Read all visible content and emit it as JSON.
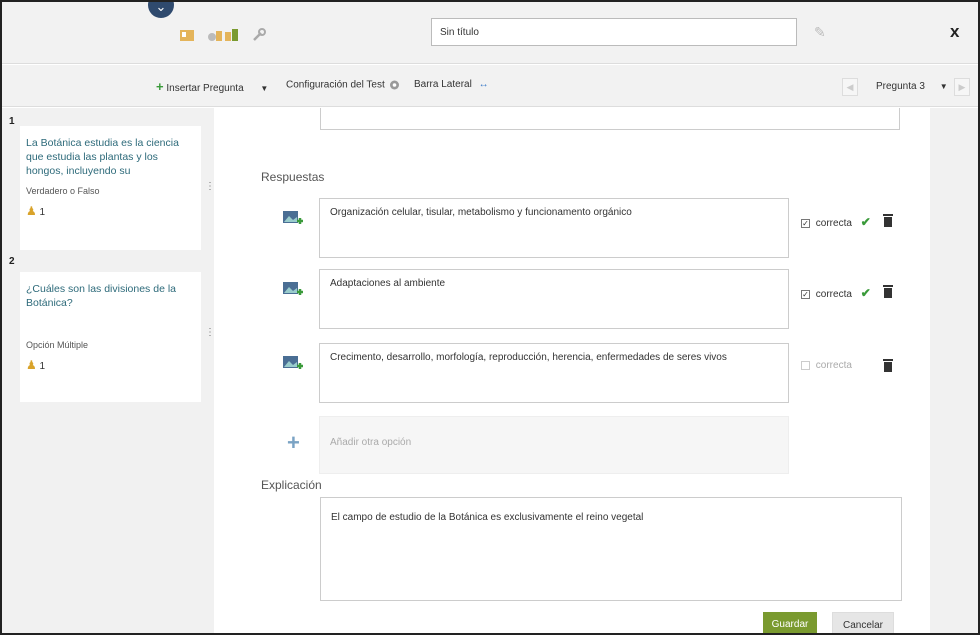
{
  "header": {
    "title_value": "Sin título",
    "close_label": "x"
  },
  "toolbar": {
    "insert_label": "Insertar Pregunta",
    "config_label": "Configuración del Test",
    "sidebar_label": "Barra Lateral",
    "pregunta_select": "Pregunta 3"
  },
  "questions": [
    {
      "number": "1",
      "text": "La Botánica estudia es la ciencia que estudia las plantas y los hongos, incluyendo su",
      "type": "Verdadero o Falso",
      "points": "1"
    },
    {
      "number": "2",
      "text": "¿Cuáles son las divisiones de la Botánica?",
      "type": "Opción Múltiple",
      "points": "1"
    }
  ],
  "editor": {
    "answers_heading": "Respuestas",
    "answers": [
      {
        "text": "Organización celular, tisular, metabolismo y funcionamento orgánico",
        "correct_label": "correcta",
        "checked": true
      },
      {
        "text": "Adaptaciones al ambiente",
        "correct_label": "correcta",
        "checked": true
      },
      {
        "text": "Crecimento, desarrollo, morfología, reproducción, herencia, enfermedades de seres vivos",
        "correct_label": "correcta",
        "checked": false
      }
    ],
    "add_option_placeholder": "Añadir otra opción",
    "explanation_heading": "Explicación",
    "explanation_text": "El campo de estudio de la Botánica es exclusivamente el reino vegetal",
    "save_label": "Guardar",
    "cancel_label": "Cancelar"
  },
  "colors": {
    "accent_green": "#7a9a2f",
    "link_teal": "#2d6a7a",
    "check_green": "#3a9a3a"
  }
}
